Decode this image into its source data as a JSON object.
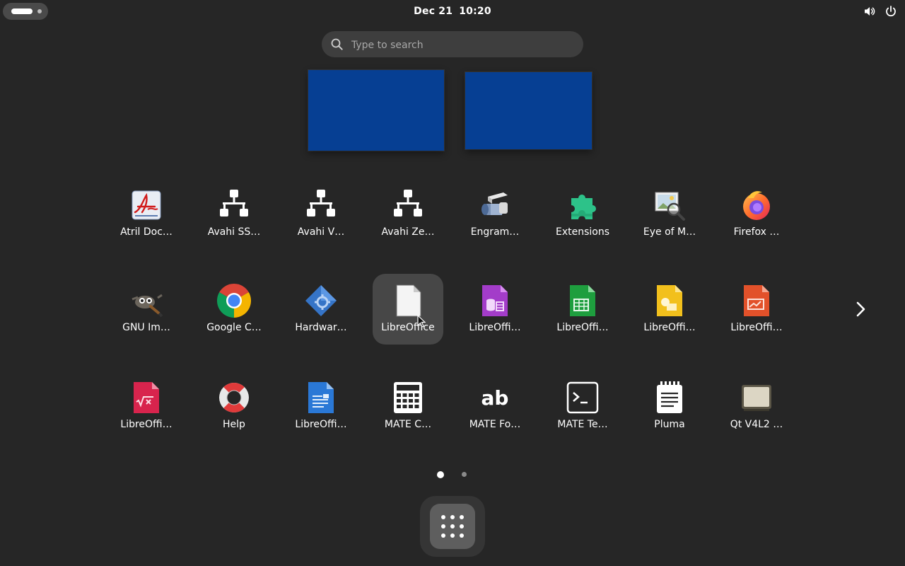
{
  "topbar": {
    "date": "Dec 21",
    "time": "10:20",
    "icons": [
      "activities-indicator",
      "volume-icon",
      "power-icon"
    ]
  },
  "search": {
    "placeholder": "Type to search",
    "value": ""
  },
  "workspaces": [
    {
      "name": "workspace-1",
      "color": "#063f93"
    },
    {
      "name": "workspace-2",
      "color": "#063f93"
    }
  ],
  "apps": {
    "row1": [
      {
        "label": "Atril Doc…",
        "icon": "atril-icon"
      },
      {
        "label": "Avahi SS…",
        "icon": "network-icon"
      },
      {
        "label": "Avahi V…",
        "icon": "network-icon"
      },
      {
        "label": "Avahi Ze…",
        "icon": "network-icon"
      },
      {
        "label": "Engram…",
        "icon": "engrampa-icon"
      },
      {
        "label": "Extensions",
        "icon": "puzzle-icon"
      },
      {
        "label": "Eye of M…",
        "icon": "image-viewer-icon"
      },
      {
        "label": "Firefox …",
        "icon": "firefox-icon"
      }
    ],
    "row2": [
      {
        "label": "GNU Im…",
        "icon": "gimp-icon"
      },
      {
        "label": "Google C…",
        "icon": "chrome-icon"
      },
      {
        "label": "Hardwar…",
        "icon": "hardware-icon"
      },
      {
        "label": "LibreOffice",
        "icon": "libreoffice-icon"
      },
      {
        "label": "LibreOffi…",
        "icon": "libreoffice-base-icon"
      },
      {
        "label": "LibreOffi…",
        "icon": "libreoffice-calc-icon"
      },
      {
        "label": "LibreOffi…",
        "icon": "libreoffice-draw-icon"
      },
      {
        "label": "LibreOffi…",
        "icon": "libreoffice-impress-icon"
      }
    ],
    "row3": [
      {
        "label": "LibreOffi…",
        "icon": "libreoffice-math-icon"
      },
      {
        "label": "Help",
        "icon": "help-lifebuoy-icon"
      },
      {
        "label": "LibreOffi…",
        "icon": "libreoffice-writer-icon"
      },
      {
        "label": "MATE C…",
        "icon": "calculator-icon"
      },
      {
        "label": "MATE Fo…",
        "icon": "font-viewer-icon"
      },
      {
        "label": "MATE Te…",
        "icon": "terminal-icon"
      },
      {
        "label": "Pluma",
        "icon": "text-editor-icon"
      },
      {
        "label": "Qt V4L2 …",
        "icon": "webcam-icon"
      }
    ]
  },
  "pagination": {
    "pages": 2,
    "current": 1
  },
  "colors": {
    "background": "#262626",
    "workspace": "#063f93",
    "hover_tile": "#474747"
  }
}
